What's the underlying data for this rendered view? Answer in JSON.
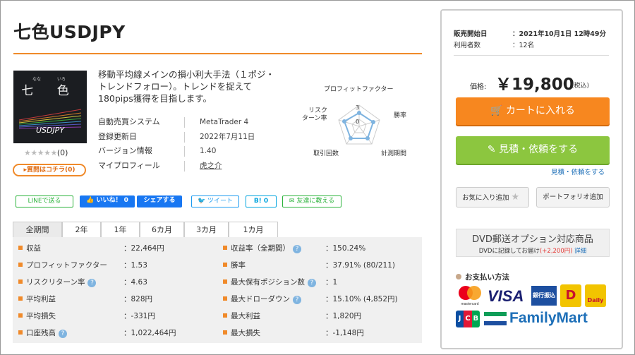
{
  "title": "七色USDJPY",
  "product": {
    "thumb_kanji": "七 色",
    "thumb_ruby_1": "なな",
    "thumb_ruby_2": "いろ",
    "thumb_en": "USDJPY",
    "stars": "★★★★★",
    "review_count": "(0)",
    "kochira": "▸質問はコチラ(0)",
    "description": "移動平均線メインの損小利大手法（１ポジ・トレンドフォロー）。トレンドを捉えて180pips獲得を目指します。",
    "specs": [
      {
        "label": "自動売買システム",
        "value": "MetaTrader 4"
      },
      {
        "label": "登録更新日",
        "value": "2022年7月11日"
      },
      {
        "label": "バージョン情報",
        "value": "1.40"
      },
      {
        "label": "マイプロフィール",
        "value": "虎之介"
      }
    ]
  },
  "radar": {
    "labels": [
      "プロフィットファクター",
      "勝率",
      "計測期間",
      "取引回数",
      "リスク\nターン率"
    ],
    "label_top": "プロフィットファクター",
    "label_right": "勝率",
    "label_br": "計測期間",
    "label_bl": "取引回数",
    "label_left_1": "リスク",
    "label_left_2": "ターン率",
    "scale_3": "3",
    "scale_0": "0",
    "color": "#7fb4e0"
  },
  "social": {
    "line": "LINEで送る",
    "like": "いいね！ 0",
    "share": "シェアする",
    "tweet": "ツイート",
    "hatena": "B! 0",
    "friend": "友達に教える"
  },
  "tabs": [
    "全期間",
    "2年",
    "1年",
    "6カ月",
    "3カ月",
    "1カ月"
  ],
  "stats_left": [
    {
      "label": "収益",
      "value": "：22,464円",
      "help": false
    },
    {
      "label": "プロフィットファクター",
      "value": "：1.53",
      "help": false
    },
    {
      "label": "リスクリターン率",
      "value": "：4.63",
      "help": true
    },
    {
      "label": "平均利益",
      "value": "：828円",
      "help": false
    },
    {
      "label": "平均損失",
      "value": "：-331円",
      "help": false
    },
    {
      "label": "口座残高",
      "value": "：1,022,464円",
      "help": true
    }
  ],
  "stats_right": [
    {
      "label": "収益率（全期間）",
      "value": "：150.24%",
      "help": true
    },
    {
      "label": "勝率",
      "value": "：37.91% (80/211)",
      "help": false
    },
    {
      "label": "最大保有ポジション数",
      "value": "：1",
      "help": true
    },
    {
      "label": "最大ドローダウン",
      "value": "：15.10% (4,852円)",
      "help": true
    },
    {
      "label": "最大利益",
      "value": "：1,820円",
      "help": false
    },
    {
      "label": "最大損失",
      "value": "：-1,148円",
      "help": false
    }
  ],
  "sidebar": {
    "sale_start_label": "販売開始日",
    "sale_start_value": "：2021年10月1日 12時49分",
    "users_label": "利用者数",
    "users_value": "：12名",
    "price_label": "価格:",
    "price": "￥19,800",
    "price_tax": "(税込)",
    "cart_button": "カートに入れる",
    "estimate_button": "見積・依頼をする",
    "estimate_link": "見積・依頼をする",
    "favorite_button": "お気に入り追加",
    "portfolio_button": "ポートフォリオ追加",
    "dvd_title": "DVD郵送オプション対応商品",
    "dvd_sub": "DVDに記録してお届け",
    "dvd_price": "(+2,200円)",
    "dvd_link": "詳細",
    "payment_heading": "お支払い方法",
    "pay_mastercard": "mastercard",
    "pay_visa": "VISA",
    "pay_bank": "銀行振込",
    "pay_daily": "Daily",
    "pay_jcb": "JCB",
    "pay_familymart": "FamilyMart"
  },
  "colors": {
    "accent": "#f08a2a",
    "cart": "#f7871f",
    "estimate": "#8cc63f",
    "link": "#1d6fb8"
  }
}
